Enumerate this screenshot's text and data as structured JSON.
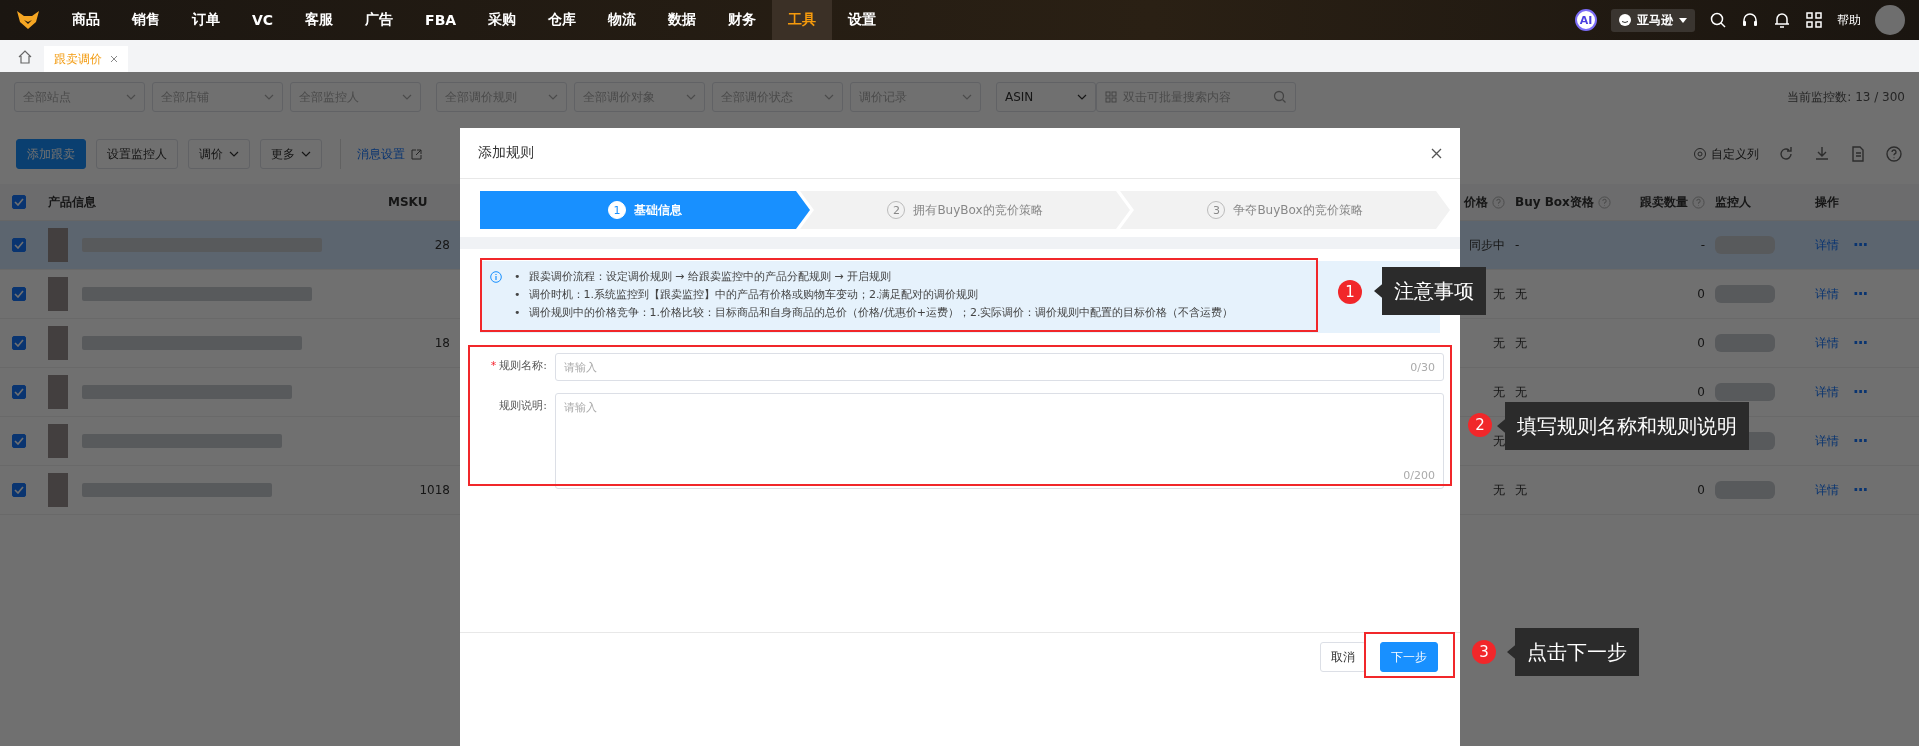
{
  "nav": {
    "items": [
      {
        "label": "商品",
        "selected": false
      },
      {
        "label": "销售",
        "selected": false
      },
      {
        "label": "订单",
        "selected": false
      },
      {
        "label": "VC",
        "selected": false
      },
      {
        "label": "客服",
        "selected": false
      },
      {
        "label": "广告",
        "selected": false
      },
      {
        "label": "FBA",
        "selected": false
      },
      {
        "label": "采购",
        "selected": false
      },
      {
        "label": "仓库",
        "selected": false
      },
      {
        "label": "物流",
        "selected": false
      },
      {
        "label": "数据",
        "selected": false
      },
      {
        "label": "财务",
        "selected": false
      },
      {
        "label": "工具",
        "selected": true
      },
      {
        "label": "设置",
        "selected": false
      }
    ],
    "ai_badge": "AI",
    "marketplace": "亚马逊",
    "help": "帮助"
  },
  "tabs": [
    {
      "label": "跟卖调价",
      "selected": true
    }
  ],
  "filters": [
    {
      "placeholder": "全部站点"
    },
    {
      "placeholder": "全部店铺"
    },
    {
      "placeholder": "全部监控人"
    },
    {
      "placeholder": "全部调价规则"
    },
    {
      "placeholder": "全部调价对象"
    },
    {
      "placeholder": "全部调价状态"
    },
    {
      "placeholder": "调价记录"
    }
  ],
  "search": {
    "field": "ASIN",
    "placeholder": "双击可批量搜索内容"
  },
  "monitor_count": "当前监控数: 13 / 300",
  "toolbar": {
    "buttons": [
      {
        "label": "添加跟卖",
        "kind": "primary"
      },
      {
        "label": "设置监控人",
        "kind": "default"
      },
      {
        "label": "调价",
        "kind": "dropdown"
      },
      {
        "label": "更多",
        "kind": "dropdown"
      },
      {
        "label": "消息设置",
        "kind": "link"
      }
    ],
    "custom_columns": "自定义列"
  },
  "table": {
    "all_checked": true,
    "columns": [
      {
        "label": "产品信息",
        "help": false
      },
      {
        "label": "MSKU",
        "help": false
      },
      {
        "label": "价格",
        "help": true
      },
      {
        "label": "Buy Box资格",
        "help": true
      },
      {
        "label": "跟卖数量",
        "help": true
      },
      {
        "label": "监控人",
        "help": false
      },
      {
        "label": "操作",
        "help": false
      }
    ],
    "rows": [
      {
        "checked": true,
        "selected": true,
        "msku": "28",
        "price": "同步中",
        "buybox": "-",
        "count": "-",
        "detail": "详情",
        "more": "···"
      },
      {
        "checked": true,
        "selected": false,
        "price": "无",
        "buybox": "无",
        "count": "0",
        "detail": "详情",
        "more": "···"
      },
      {
        "checked": true,
        "selected": false,
        "msku": "18",
        "price": "无",
        "buybox": "无",
        "count": "0",
        "detail": "详情",
        "more": "···"
      },
      {
        "checked": true,
        "selected": false,
        "price": "无",
        "buybox": "无",
        "count": "0",
        "detail": "详情",
        "more": "···"
      },
      {
        "checked": true,
        "selected": false,
        "price": "无",
        "detail": "详情",
        "more": "···"
      },
      {
        "checked": true,
        "selected": false,
        "msku": "1018",
        "price": "无",
        "buybox": "无",
        "count": "0",
        "detail": "详情",
        "more": "···"
      }
    ]
  },
  "modal": {
    "title": "添加规则",
    "steps": [
      {
        "number": "1",
        "label": "基础信息",
        "selected": true
      },
      {
        "number": "2",
        "label": "拥有BuyBox的竞价策略",
        "selected": false
      },
      {
        "number": "3",
        "label": "争夺BuyBox的竞价策略",
        "selected": false
      }
    ],
    "bullet": "•",
    "notices": [
      "跟卖调价流程：设定调价规则 → 给跟卖监控中的产品分配规则 → 开启规则",
      "调价时机：1.系统监控到【跟卖监控】中的产品有价格或购物车变动；2.满足配对的调价规则",
      "调价规则中的价格竞争：1.价格比较：目标商品和自身商品的总价（价格/优惠价+运费）；2.实际调价：调价规则中配置的目标价格（不含运费）"
    ],
    "fields": [
      {
        "kind": "input",
        "label": "规则名称:",
        "required_mark": "*",
        "placeholder": "请输入",
        "counter": "0/30"
      },
      {
        "kind": "textarea",
        "label": "规则说明:",
        "placeholder": "请输入",
        "counter": "0/200"
      }
    ],
    "buttons": [
      {
        "label": "取消",
        "kind": "default"
      },
      {
        "label": "下一步",
        "kind": "primary"
      }
    ]
  },
  "annotations": [
    {
      "number": "1",
      "text": "注意事项"
    },
    {
      "number": "2",
      "text": "填写规则名称和规则说明"
    },
    {
      "number": "3",
      "text": "点击下一步"
    }
  ]
}
